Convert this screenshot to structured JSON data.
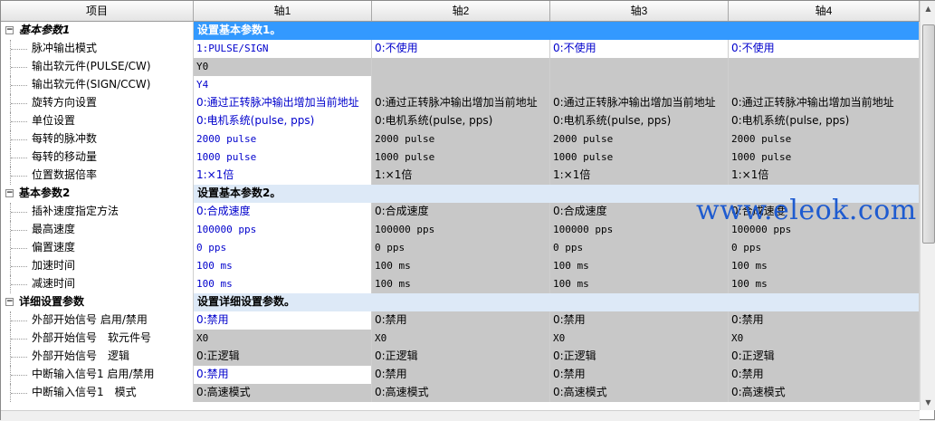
{
  "header": {
    "col0": "项目",
    "col1": "轴1",
    "col2": "轴2",
    "col3": "轴3",
    "col4": "轴4"
  },
  "groups": [
    {
      "name": "基本参数1",
      "desc": "设置基本参数1。",
      "rows": [
        {
          "name": "脉冲输出模式",
          "axis1": "1:PULSE/SIGN",
          "axis2": "0:不使用",
          "axis3": "0:不使用",
          "axis4": "0:不使用"
        },
        {
          "name": "输出软元件(PULSE/CW)",
          "axis1": "Y0",
          "axis2": "",
          "axis3": "",
          "axis4": ""
        },
        {
          "name": "输出软元件(SIGN/CCW)",
          "axis1": "Y4",
          "axis2": "",
          "axis3": "",
          "axis4": ""
        },
        {
          "name": "旋转方向设置",
          "axis1": "0:通过正转脉冲输出增加当前地址",
          "axis2": "0:通过正转脉冲输出增加当前地址",
          "axis3": "0:通过正转脉冲输出增加当前地址",
          "axis4": "0:通过正转脉冲输出增加当前地址"
        },
        {
          "name": "单位设置",
          "axis1": "0:电机系统(pulse, pps)",
          "axis2": "0:电机系统(pulse, pps)",
          "axis3": "0:电机系统(pulse, pps)",
          "axis4": "0:电机系统(pulse, pps)"
        },
        {
          "name": "每转的脉冲数",
          "axis1": "2000 pulse",
          "axis2": "2000 pulse",
          "axis3": "2000 pulse",
          "axis4": "2000 pulse"
        },
        {
          "name": "每转的移动量",
          "axis1": "1000 pulse",
          "axis2": "1000 pulse",
          "axis3": "1000 pulse",
          "axis4": "1000 pulse"
        },
        {
          "name": "位置数据倍率",
          "axis1": "1:×1倍",
          "axis2": "1:×1倍",
          "axis3": "1:×1倍",
          "axis4": "1:×1倍"
        }
      ]
    },
    {
      "name": "基本参数2",
      "desc": "设置基本参数2。",
      "rows": [
        {
          "name": "插补速度指定方法",
          "axis1": "0:合成速度",
          "axis2": "0:合成速度",
          "axis3": "0:合成速度",
          "axis4": "0:合成速度"
        },
        {
          "name": "最高速度",
          "axis1": "100000 pps",
          "axis2": "100000 pps",
          "axis3": "100000 pps",
          "axis4": "100000 pps"
        },
        {
          "name": "偏置速度",
          "axis1": "0 pps",
          "axis2": "0 pps",
          "axis3": "0 pps",
          "axis4": "0 pps"
        },
        {
          "name": "加速时间",
          "axis1": "100 ms",
          "axis2": "100 ms",
          "axis3": "100 ms",
          "axis4": "100 ms"
        },
        {
          "name": "减速时间",
          "axis1": "100 ms",
          "axis2": "100 ms",
          "axis3": "100 ms",
          "axis4": "100 ms"
        }
      ]
    },
    {
      "name": "详细设置参数",
      "desc": "设置详细设置参数。",
      "rows": [
        {
          "name": "外部开始信号 启用/禁用",
          "axis1": "0:禁用",
          "axis2": "0:禁用",
          "axis3": "0:禁用",
          "axis4": "0:禁用"
        },
        {
          "name": "外部开始信号　软元件号",
          "axis1": "X0",
          "axis2": "X0",
          "axis3": "X0",
          "axis4": "X0"
        },
        {
          "name": "外部开始信号　逻辑",
          "axis1": "0:正逻辑",
          "axis2": "0:正逻辑",
          "axis3": "0:正逻辑",
          "axis4": "0:正逻辑"
        },
        {
          "name": "中断输入信号1 启用/禁用",
          "axis1": "0:禁用",
          "axis2": "0:禁用",
          "axis3": "0:禁用",
          "axis4": "0:禁用"
        },
        {
          "name": "中断输入信号1　模式",
          "axis1": "0:高速模式",
          "axis2": "0:高速模式",
          "axis3": "0:高速模式",
          "axis4": "0:高速模式"
        }
      ]
    }
  ],
  "watermark": "www.eleok.com",
  "colors": {
    "selected": "#3399ff",
    "group_bg": "#dde9f7",
    "disabled_cell": "#c8c8c8",
    "value_text": "#0000cc"
  }
}
